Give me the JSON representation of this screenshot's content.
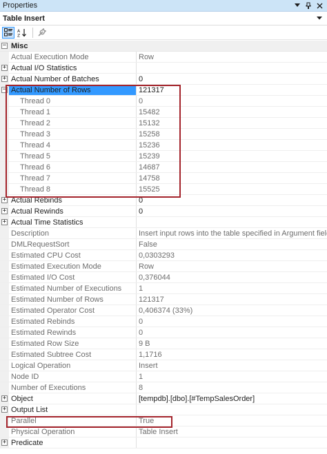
{
  "window": {
    "title": "Properties"
  },
  "object": {
    "name": "Table Insert"
  },
  "category": {
    "label": "Misc",
    "expander": "⊟"
  },
  "rows": [
    {
      "name": "Actual Execution Mode",
      "value": "Row",
      "kind": "ro",
      "exp": ""
    },
    {
      "name": "Actual I/O Statistics",
      "value": "",
      "kind": "dark",
      "exp": "+"
    },
    {
      "name": "Actual Number of Batches",
      "value": "0",
      "kind": "dark",
      "exp": "+"
    },
    {
      "name": "Actual Number of Rows",
      "value": "121317",
      "kind": "dark selected",
      "exp": "−"
    },
    {
      "name": "Thread 0",
      "value": "0",
      "kind": "ro child",
      "exp": ""
    },
    {
      "name": "Thread 1",
      "value": "15482",
      "kind": "ro child",
      "exp": ""
    },
    {
      "name": "Thread 2",
      "value": "15132",
      "kind": "ro child",
      "exp": ""
    },
    {
      "name": "Thread 3",
      "value": "15258",
      "kind": "ro child",
      "exp": ""
    },
    {
      "name": "Thread 4",
      "value": "15236",
      "kind": "ro child",
      "exp": ""
    },
    {
      "name": "Thread 5",
      "value": "15239",
      "kind": "ro child",
      "exp": ""
    },
    {
      "name": "Thread 6",
      "value": "14687",
      "kind": "ro child",
      "exp": ""
    },
    {
      "name": "Thread 7",
      "value": "14758",
      "kind": "ro child",
      "exp": ""
    },
    {
      "name": "Thread 8",
      "value": "15525",
      "kind": "ro child",
      "exp": ""
    },
    {
      "name": "Actual Rebinds",
      "value": "0",
      "kind": "dark",
      "exp": "+"
    },
    {
      "name": "Actual Rewinds",
      "value": "0",
      "kind": "dark",
      "exp": "+"
    },
    {
      "name": "Actual Time Statistics",
      "value": "",
      "kind": "dark",
      "exp": "+"
    },
    {
      "name": "Description",
      "value": "Insert input rows into the table specified in Argument field.",
      "kind": "ro",
      "exp": ""
    },
    {
      "name": "DMLRequestSort",
      "value": "False",
      "kind": "ro",
      "exp": ""
    },
    {
      "name": "Estimated CPU Cost",
      "value": "0,0303293",
      "kind": "ro",
      "exp": ""
    },
    {
      "name": "Estimated Execution Mode",
      "value": "Row",
      "kind": "ro",
      "exp": ""
    },
    {
      "name": "Estimated I/O Cost",
      "value": "0,376044",
      "kind": "ro",
      "exp": ""
    },
    {
      "name": "Estimated Number of Executions",
      "value": "1",
      "kind": "ro",
      "exp": ""
    },
    {
      "name": "Estimated Number of Rows",
      "value": "121317",
      "kind": "ro",
      "exp": ""
    },
    {
      "name": "Estimated Operator Cost",
      "value": "0,406374 (33%)",
      "kind": "ro",
      "exp": ""
    },
    {
      "name": "Estimated Rebinds",
      "value": "0",
      "kind": "ro",
      "exp": ""
    },
    {
      "name": "Estimated Rewinds",
      "value": "0",
      "kind": "ro",
      "exp": ""
    },
    {
      "name": "Estimated Row Size",
      "value": "9 B",
      "kind": "ro",
      "exp": ""
    },
    {
      "name": "Estimated Subtree Cost",
      "value": "1,1716",
      "kind": "ro",
      "exp": ""
    },
    {
      "name": "Logical Operation",
      "value": "Insert",
      "kind": "ro",
      "exp": ""
    },
    {
      "name": "Node ID",
      "value": "1",
      "kind": "ro",
      "exp": ""
    },
    {
      "name": "Number of Executions",
      "value": "8",
      "kind": "ro",
      "exp": ""
    },
    {
      "name": "Object",
      "value": "[tempdb].[dbo].[#TempSalesOrder]",
      "kind": "dark",
      "exp": "+"
    },
    {
      "name": "Output List",
      "value": "",
      "kind": "dark",
      "exp": "+"
    },
    {
      "name": "Parallel",
      "value": "True",
      "kind": "ro",
      "exp": ""
    },
    {
      "name": "Physical Operation",
      "value": "Table Insert",
      "kind": "ro",
      "exp": ""
    },
    {
      "name": "Predicate",
      "value": "",
      "kind": "dark",
      "exp": "+"
    }
  ]
}
